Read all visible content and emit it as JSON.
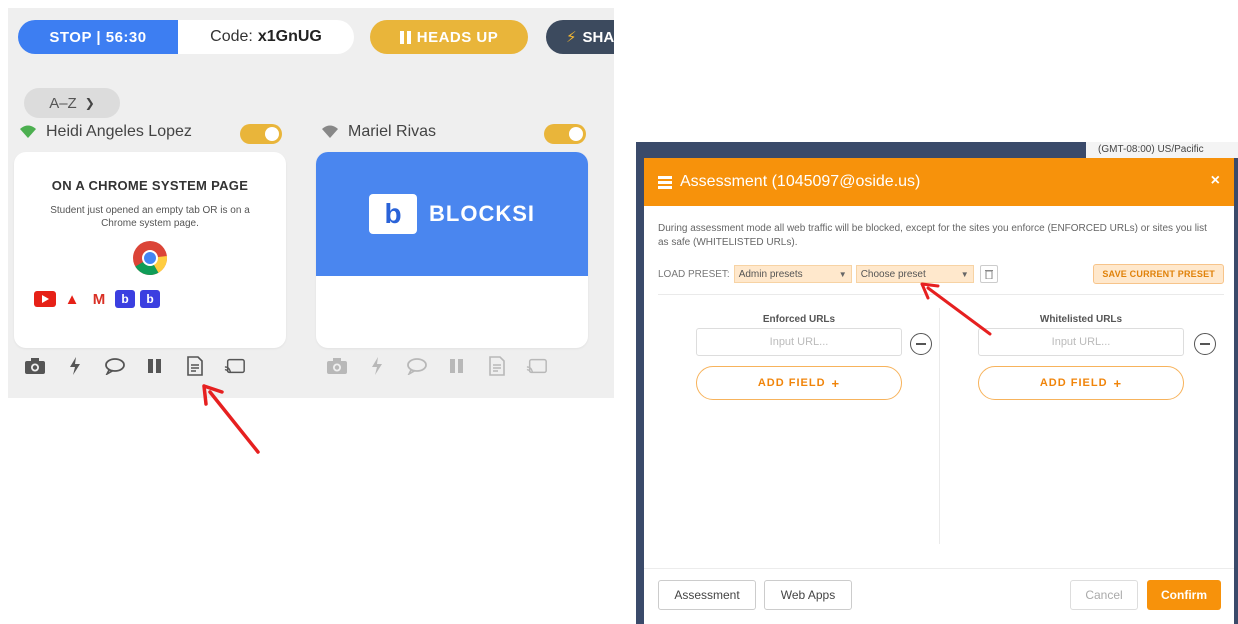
{
  "session": {
    "stop_label": "STOP | 56:30",
    "code_label": "Code:",
    "code_value": "x1GnUG",
    "heads_up_label": "HEADS UP",
    "share_label": "SHA"
  },
  "sort": {
    "label": "A–Z"
  },
  "students": [
    {
      "name": "Heidi Angeles Lopez",
      "card_title": "ON A CHROME SYSTEM PAGE",
      "card_desc": "Student just opened an empty tab OR is on a Chrome system page."
    },
    {
      "name": "Mariel Rivas",
      "banner_text": "BLOCKSI",
      "banner_logo_letter": "b"
    }
  ],
  "favicons": [
    "youtube-icon",
    "adobe-icon",
    "gmail-icon",
    "blocksi-icon",
    "blocksi-icon"
  ],
  "background_timezone": "(GMT-08:00) US/Pacific",
  "modal": {
    "title": "Assessment (1045097@oside.us)",
    "close_glyph": "×",
    "description": "During assessment mode all web traffic will be blocked, except for the sites you enforce (ENFORCED URLs) or sites you list as safe (WHITELISTED URLs).",
    "load_preset_label": "LOAD PRESET:",
    "preset_group": "Admin presets",
    "preset_choice": "Choose preset",
    "save_preset_label": "SAVE CURRENT PRESET",
    "enforced_label": "Enforced URLs",
    "whitelisted_label": "Whitelisted URLs",
    "url_placeholder": "Input URL...",
    "add_field_label": "ADD FIELD",
    "footer": {
      "assessment_label": "Assessment",
      "web_apps_label": "Web Apps",
      "cancel_label": "Cancel",
      "confirm_label": "Confirm"
    }
  },
  "colors": {
    "stop_blue": "#3d7ef2",
    "heads_up_yellow": "#e9b53a",
    "share_dark": "#3c4a5e",
    "modal_orange": "#f7920b",
    "blocksi_blue": "#4a86ef",
    "annotation_red": "#e62020"
  }
}
